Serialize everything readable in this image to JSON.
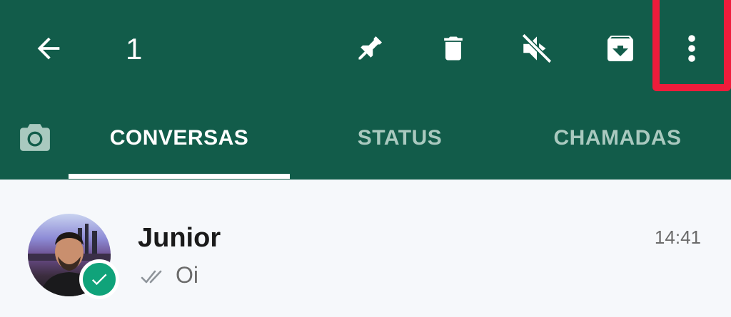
{
  "selection": {
    "count": "1"
  },
  "colors": {
    "header_bg": "#125c4a",
    "highlight": "#ee1c3b",
    "badge": "#10a37a",
    "list_bg": "#f6f8fb"
  },
  "toolbar": {
    "icons": [
      "arrow-back-icon",
      "pin-icon",
      "trash-icon",
      "mute-icon",
      "archive-icon",
      "more-vertical-icon"
    ]
  },
  "tabs": [
    {
      "label": "CONVERSAS",
      "active": true
    },
    {
      "label": "STATUS",
      "active": false
    },
    {
      "label": "CHAMADAS",
      "active": false
    }
  ],
  "chats": [
    {
      "name": "Junior",
      "time": "14:41",
      "preview": "Oi",
      "selected": true
    }
  ]
}
